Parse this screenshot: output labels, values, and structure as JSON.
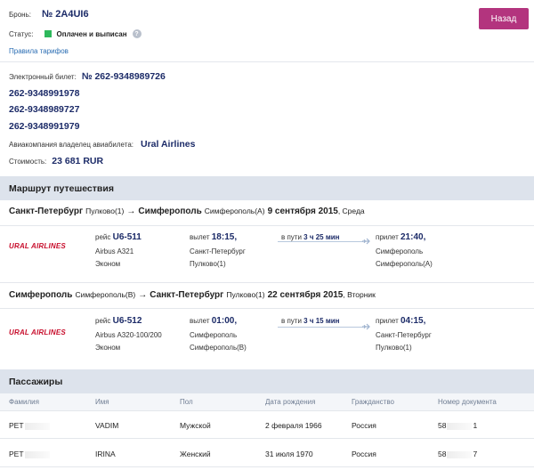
{
  "header": {
    "booking_label": "Бронь:",
    "booking_number": "№ 2A4UI6",
    "status_label": "Статус:",
    "status_text": "Оплачен и выписан",
    "status_color": "#2eb85c",
    "help_icon": "?",
    "tariff_link": "Правила тарифов",
    "back_button": "Назад"
  },
  "ticket": {
    "eticket_label": "Электронный билет:",
    "eticket_first": "№ 262-9348989726",
    "eticket_more": [
      "262-9348991978",
      "262-9348989727",
      "262-9348991979"
    ],
    "airline_label": "Авиакомпания владелец авиабилета:",
    "airline_name": "Ural Airlines",
    "cost_label": "Стоимость:",
    "cost_value": "23 681 RUR"
  },
  "route": {
    "title": "Маршрут путешествия",
    "segments": [
      {
        "from_city": "Санкт-Петербург",
        "from_airport": "Пулково(1)",
        "arrow": "→",
        "to_city": "Симферополь",
        "to_airport": "Симферополь(A)",
        "date": "9 сентября 2015",
        "weekday": ", Среда",
        "logo": "URAL AIRLINES",
        "flight_label": "рейс",
        "flight_number": "U6-511",
        "aircraft": "Airbus A321",
        "cabin": "Эконом",
        "dep_label": "вылет",
        "dep_time": "18:15,",
        "dep_city": "Санкт-Петербург",
        "dep_airport": "Пулково(1)",
        "travel_label": "в пути",
        "travel_time": "3 ч 25 мин",
        "arr_label": "прилет",
        "arr_time": "21:40,",
        "arr_city": "Симферополь",
        "arr_airport": "Симферополь(A)"
      },
      {
        "from_city": "Симферополь",
        "from_airport": "Симферополь(B)",
        "arrow": "→",
        "to_city": "Санкт-Петербург",
        "to_airport": "Пулково(1)",
        "date": "22 сентября 2015",
        "weekday": ", Вторник",
        "logo": "URAL AIRLINES",
        "flight_label": "рейс",
        "flight_number": "U6-512",
        "aircraft": "Airbus A320-100/200",
        "cabin": "Эконом",
        "dep_label": "вылет",
        "dep_time": "01:00,",
        "dep_city": "Симферополь",
        "dep_airport": "Симферополь(B)",
        "travel_label": "в пути",
        "travel_time": "3 ч 15 мин",
        "arr_label": "прилет",
        "arr_time": "04:15,",
        "arr_city": "Санкт-Петербург",
        "arr_airport": "Пулково(1)"
      }
    ]
  },
  "passengers": {
    "title": "Пассажиры",
    "columns": [
      "Фамилия",
      "Имя",
      "Пол",
      "Дата рождения",
      "Гражданство",
      "Номер документа"
    ],
    "rows": [
      {
        "surname": "PET",
        "name": "VADIM",
        "gender": "Мужской",
        "birth": "2 февраля 1966",
        "citizenship": "Россия",
        "doc_start": "58",
        "doc_end": "1"
      },
      {
        "surname": "PET",
        "name": "IRINA",
        "gender": "Женский",
        "birth": "31 июля 1970",
        "citizenship": "Россия",
        "doc_start": "58",
        "doc_end": "7"
      }
    ]
  },
  "colors": {
    "accent_button": "#b3347e",
    "navy_text": "#1c2b68",
    "link": "#2a6db3",
    "section_bg": "#dde3ec",
    "logo_red": "#c8102e"
  }
}
